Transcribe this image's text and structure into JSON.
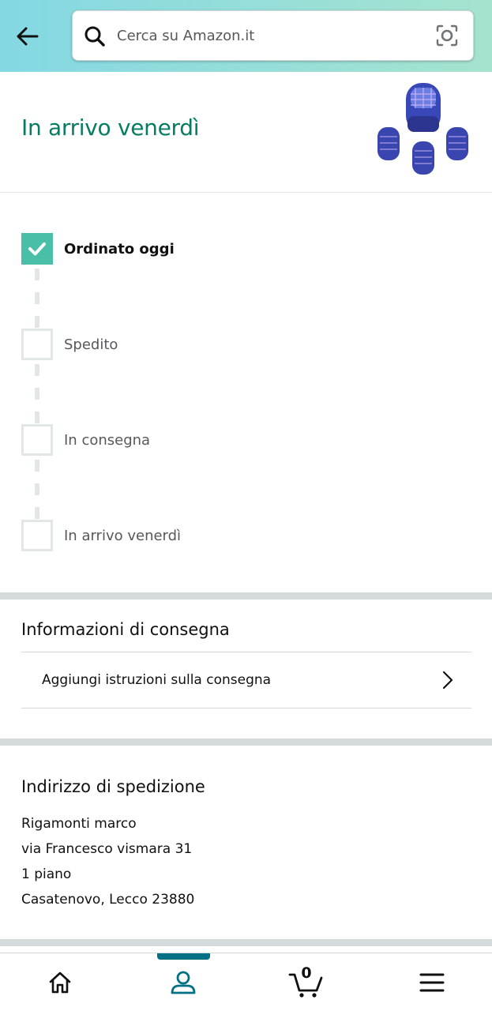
{
  "search": {
    "placeholder": "Cerca su Amazon.it"
  },
  "arrival": {
    "title": "In arrivo venerdì",
    "product_image": "product-bug-zapper-thumbnail"
  },
  "tracker": {
    "steps": [
      {
        "label": "Ordinato oggi",
        "done": true
      },
      {
        "label": "Spedito",
        "done": false
      },
      {
        "label": "In consegna",
        "done": false
      },
      {
        "label": "In arrivo venerdì",
        "done": false
      }
    ]
  },
  "delivery_info": {
    "title": "Informazioni di consegna",
    "add_instructions_label": "Aggiungi istruzioni sulla consegna"
  },
  "shipping_address": {
    "title": "Indirizzo di spedizione",
    "lines": [
      "Rigamonti marco",
      "via Francesco vismara 31",
      "1 piano",
      "Casatenovo, Lecco 23880"
    ]
  },
  "bottom_nav": {
    "items": [
      {
        "name": "home",
        "icon": "home-icon"
      },
      {
        "name": "account",
        "icon": "person-icon",
        "active": true
      },
      {
        "name": "cart",
        "icon": "cart-icon"
      },
      {
        "name": "menu",
        "icon": "hamburger-icon"
      }
    ],
    "cart_count": "0"
  },
  "colors": {
    "header_gradient_start": "#84d8e3",
    "header_gradient_end": "#a6e3cf",
    "arrival_green": "#067d62",
    "check_teal": "#48bfa6",
    "nav_active": "#007185"
  }
}
